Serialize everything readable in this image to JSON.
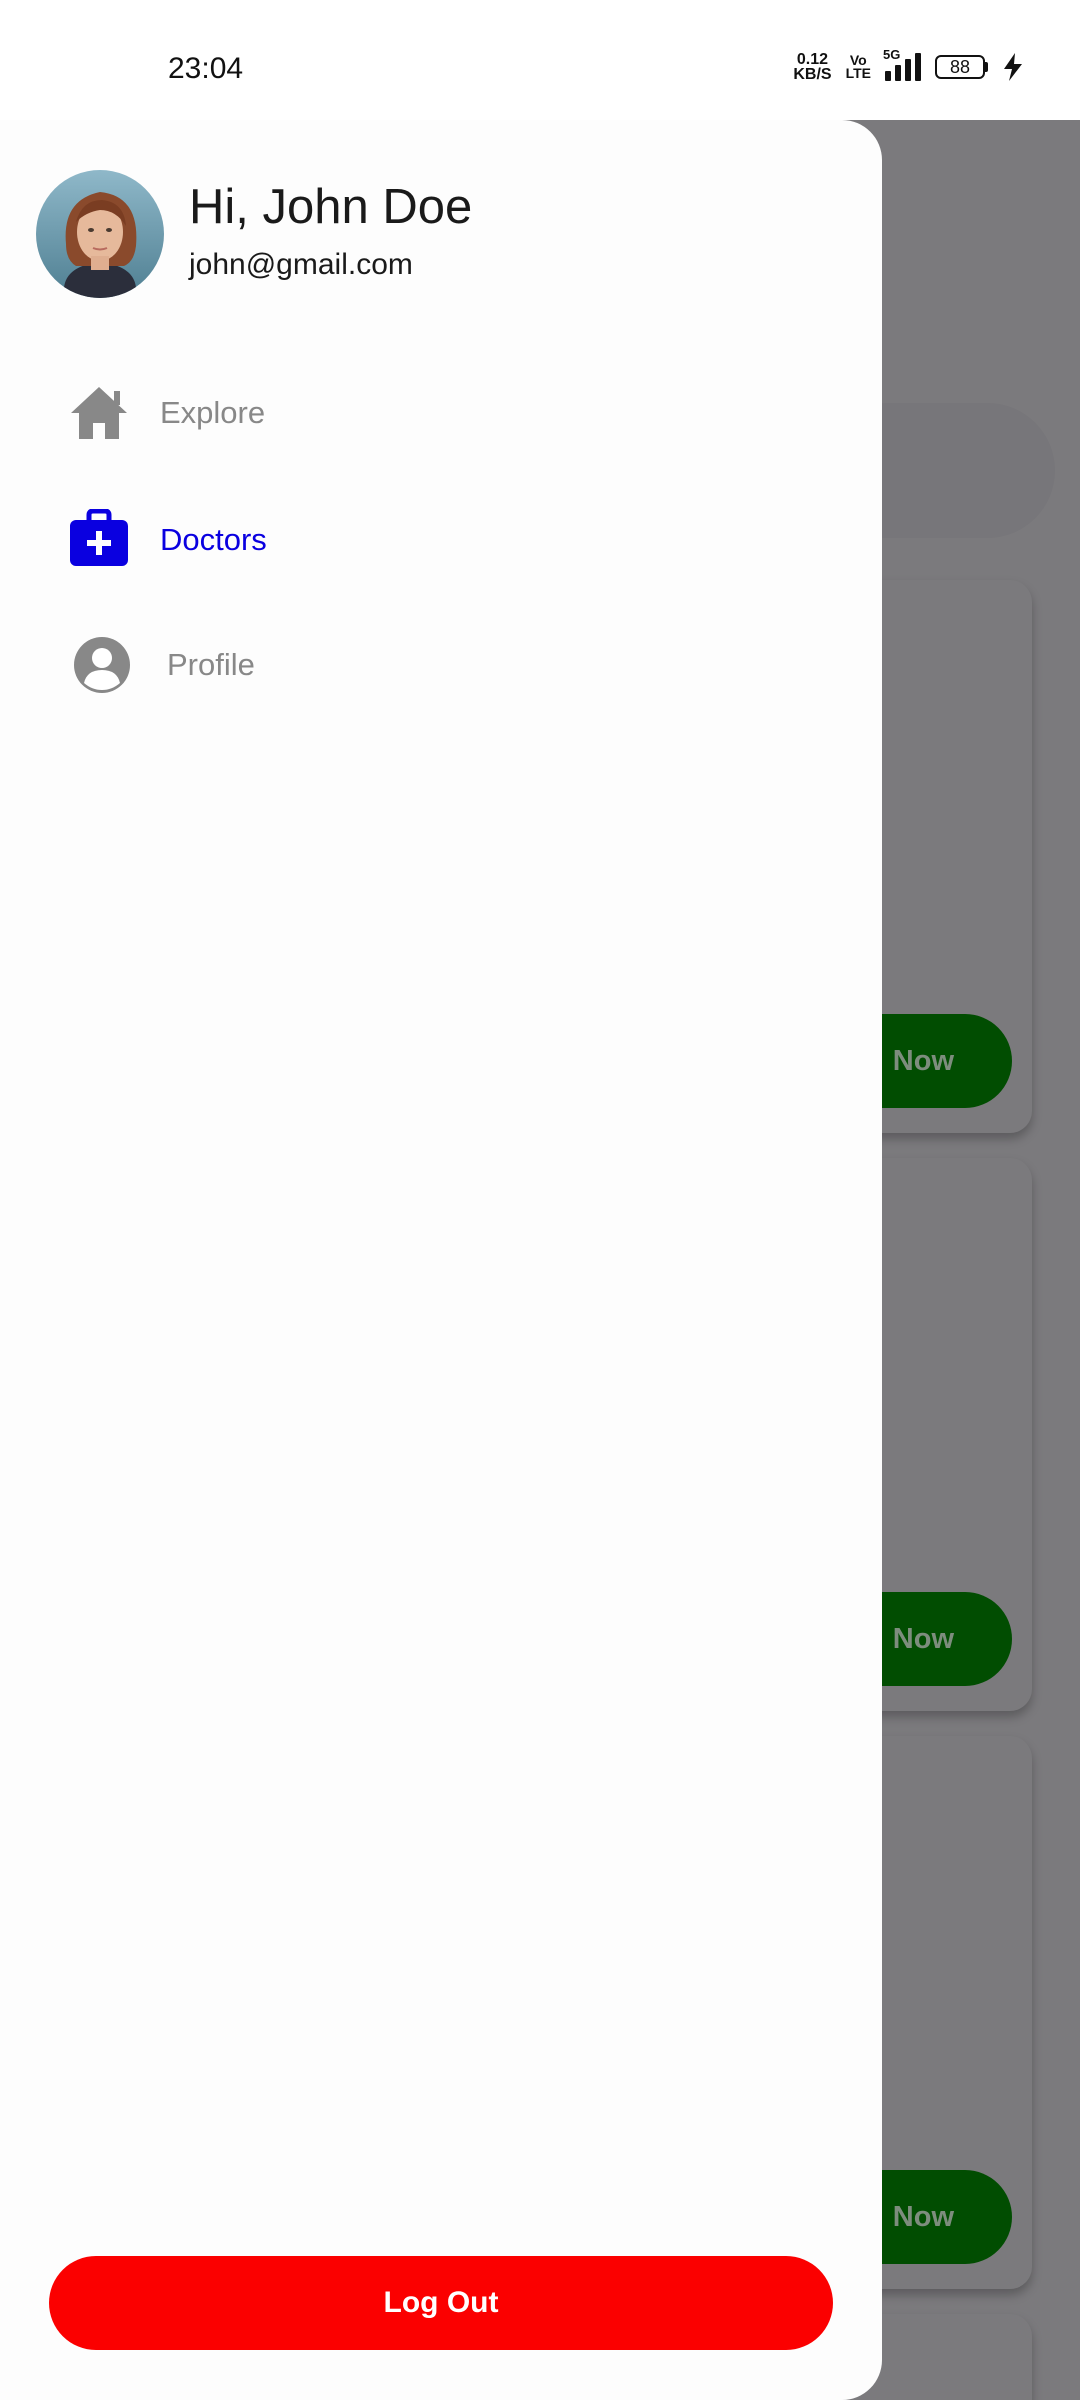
{
  "status_bar": {
    "time": "23:04",
    "net_speed_value": "0.12",
    "net_speed_unit": "KB/S",
    "volte_top": "Vo",
    "volte_bottom": "LTE",
    "network": "5G",
    "battery": "88"
  },
  "drawer": {
    "greeting": "Hi, John Doe",
    "email": "john@gmail.com",
    "items": [
      {
        "label": "Explore",
        "icon": "home-icon",
        "color": "#888888",
        "active": false
      },
      {
        "label": "Doctors",
        "icon": "medical-bag-icon",
        "color": "#0a00e0",
        "active": true
      },
      {
        "label": "Profile",
        "icon": "account-circle-icon",
        "color": "#888888",
        "active": false
      }
    ],
    "logout_label": "Log Out"
  },
  "background": {
    "card_button_label": "Now"
  },
  "colors": {
    "active": "#0a00e0",
    "inactive": "#888888",
    "logout": "#fb0000",
    "book_button": "#014d01",
    "scrim": "#7b7a7d"
  }
}
